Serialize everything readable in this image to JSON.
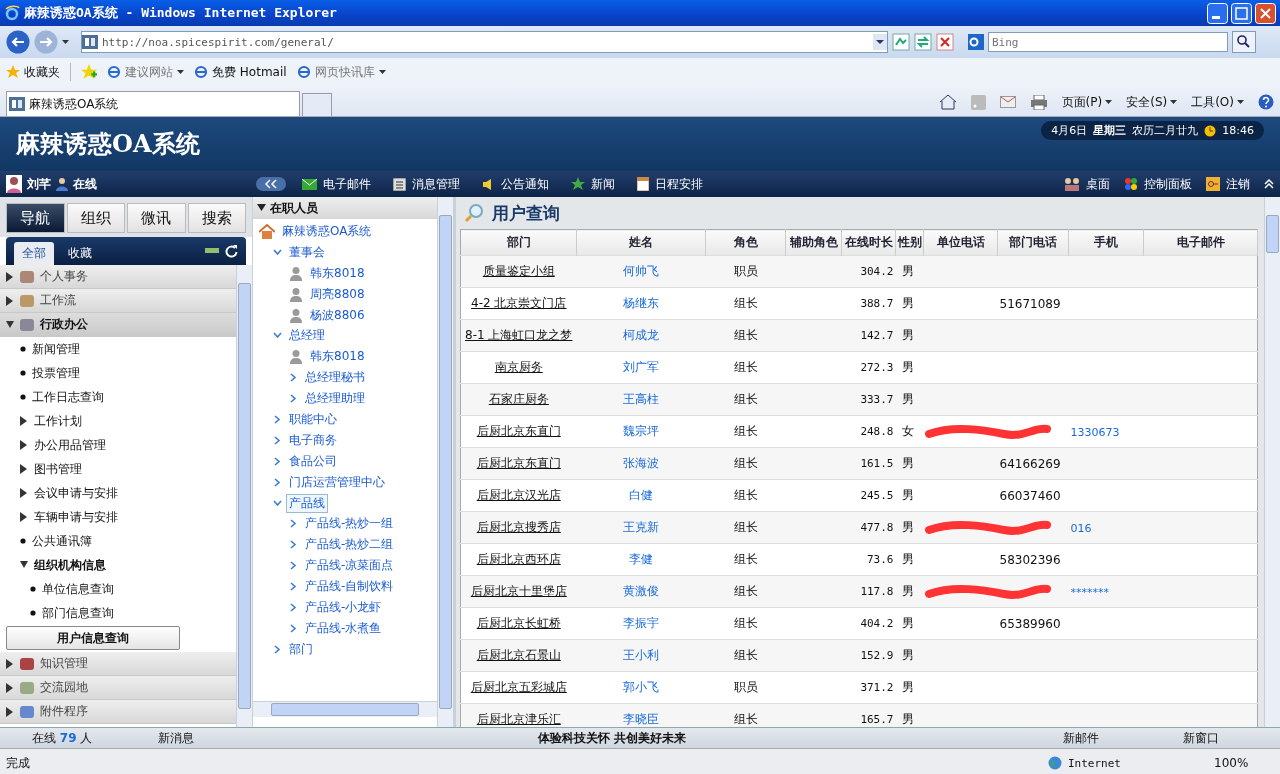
{
  "window": {
    "title": "麻辣诱惑OA系统 - Windows Internet Explorer"
  },
  "browser": {
    "url": "http://noa.spicespirit.com/general/",
    "search_placeholder": "Bing",
    "favorites": [
      {
        "label": "收藏夹",
        "kind": "star"
      },
      {
        "label": "建议网站",
        "kind": "dropdown"
      },
      {
        "label": "免费 Hotmail",
        "kind": "link"
      },
      {
        "label": "网页快讯库",
        "kind": "dropdown"
      }
    ],
    "tab": "麻辣诱惑OA系统",
    "commands": [
      "页面(P)",
      "安全(S)",
      "工具(O)"
    ],
    "status": "完成",
    "zone": "Internet",
    "zoom": "100%"
  },
  "app": {
    "title": "麻辣诱惑OA系统",
    "date": "4月6日",
    "weekday": "星期三",
    "lunar": "农历二月廿九",
    "time": "18:46",
    "user": "刘芊",
    "presence": "在线",
    "menu": [
      "电子邮件",
      "消息管理",
      "公告通知",
      "新闻",
      "日程安排"
    ],
    "right_menu": [
      "桌面",
      "控制面板",
      "注销"
    ]
  },
  "sidebar": {
    "tabs": [
      {
        "label": "导航",
        "selected": true
      },
      {
        "label": "组织",
        "selected": false
      },
      {
        "label": "微讯",
        "selected": false
      },
      {
        "label": "搜索",
        "selected": false
      }
    ],
    "subtabs": [
      {
        "label": "全部",
        "selected": true
      },
      {
        "label": "收藏",
        "selected": false
      }
    ],
    "sections": [
      {
        "label": "个人事务",
        "expanded": false
      },
      {
        "label": "工作流",
        "expanded": false
      },
      {
        "label": "行政办公",
        "expanded": true,
        "children": [
          {
            "label": "新闻管理",
            "kind": "leaf",
            "selected": false
          },
          {
            "label": "投票管理",
            "kind": "leaf",
            "selected": false
          },
          {
            "label": "工作日志查询",
            "kind": "leaf",
            "selected": false
          },
          {
            "label": "工作计划",
            "kind": "folder",
            "expanded": false
          },
          {
            "label": "办公用品管理",
            "kind": "folder",
            "expanded": false
          },
          {
            "label": "图书管理",
            "kind": "folder",
            "expanded": false
          },
          {
            "label": "会议申请与安排",
            "kind": "folder",
            "expanded": false
          },
          {
            "label": "车辆申请与安排",
            "kind": "folder",
            "expanded": false
          },
          {
            "label": "公共通讯簿",
            "kind": "leaf",
            "selected": false
          },
          {
            "label": "组织机构信息",
            "kind": "folder",
            "expanded": true,
            "children": [
              {
                "label": "单位信息查询",
                "selected": false
              },
              {
                "label": "部门信息查询",
                "selected": false
              },
              {
                "label": "用户信息查询",
                "selected": true
              }
            ]
          }
        ]
      },
      {
        "label": "知识管理",
        "expanded": false
      },
      {
        "label": "交流园地",
        "expanded": false
      },
      {
        "label": "附件程序",
        "expanded": false
      }
    ]
  },
  "tree": {
    "title": "在职人员",
    "root": "麻辣诱惑OA系统",
    "children": [
      {
        "label": "董事会",
        "kind": "group",
        "expanded": true,
        "selected": false,
        "children": [
          {
            "label": "韩东8018",
            "kind": "person"
          },
          {
            "label": "周亮8808",
            "kind": "person"
          },
          {
            "label": "杨波8806",
            "kind": "person"
          }
        ]
      },
      {
        "label": "总经理",
        "kind": "group",
        "expanded": true,
        "selected": false,
        "children": [
          {
            "label": "韩东8018",
            "kind": "person"
          },
          {
            "label": "总经理秘书",
            "kind": "group",
            "expanded": false,
            "selected": false
          },
          {
            "label": "总经理助理",
            "kind": "group",
            "expanded": false,
            "selected": false
          }
        ]
      },
      {
        "label": "职能中心",
        "kind": "group",
        "expanded": false,
        "selected": false
      },
      {
        "label": "电子商务",
        "kind": "group",
        "expanded": false,
        "selected": false
      },
      {
        "label": "食品公司",
        "kind": "group",
        "expanded": false,
        "selected": false
      },
      {
        "label": "门店运营管理中心",
        "kind": "group",
        "expanded": false,
        "selected": false
      },
      {
        "label": "产品线",
        "kind": "group",
        "expanded": true,
        "selected": true,
        "children": [
          {
            "label": "产品线-热炒一组",
            "kind": "group",
            "expanded": false,
            "selected": false
          },
          {
            "label": "产品线-热炒二组",
            "kind": "group",
            "expanded": false,
            "selected": false
          },
          {
            "label": "产品线-凉菜面点",
            "kind": "group",
            "expanded": false,
            "selected": false
          },
          {
            "label": "产品线-自制饮料",
            "kind": "group",
            "expanded": false,
            "selected": false
          },
          {
            "label": "产品线-小龙虾",
            "kind": "group",
            "expanded": false,
            "selected": false
          },
          {
            "label": "产品线-水煮鱼",
            "kind": "group",
            "expanded": false,
            "selected": false
          }
        ]
      },
      {
        "label": "部门",
        "kind": "group",
        "expanded": false,
        "selected": false
      }
    ]
  },
  "content": {
    "title": "用户查询",
    "table": {
      "columns": [
        "部门",
        "姓名",
        "角色",
        "辅助角色",
        "在线时长",
        "性别",
        "单位电话",
        "部门电话",
        "手机",
        "电子邮件"
      ],
      "rows": [
        {
          "dept": "质量鉴定小组",
          "name": "何帅飞",
          "role": "职员",
          "hours": "304.2",
          "gender": "男",
          "dept_phone": "",
          "mobile": "",
          "redacted": false
        },
        {
          "dept": "4-2 北京崇文门店",
          "name": "杨继东",
          "role": "组长",
          "hours": "388.7",
          "gender": "男",
          "dept_phone": "51671089",
          "mobile": "",
          "redacted": false
        },
        {
          "dept": "8-1 上海虹口龙之梦",
          "name": "柯成龙",
          "role": "组长",
          "hours": "142.7",
          "gender": "男",
          "dept_phone": "",
          "mobile": "",
          "redacted": false
        },
        {
          "dept": "南京厨务",
          "name": "刘广军",
          "role": "组长",
          "hours": "272.3",
          "gender": "男",
          "dept_phone": "",
          "mobile": "",
          "redacted": false
        },
        {
          "dept": "石家庄厨务",
          "name": "王高柱",
          "role": "组长",
          "hours": "333.7",
          "gender": "男",
          "dept_phone": "",
          "mobile": "",
          "redacted": false
        },
        {
          "dept": "后厨北京东直门",
          "name": "魏宗坪",
          "role": "组长",
          "hours": "248.8",
          "gender": "女",
          "dept_phone": "",
          "mobile": "1330673",
          "redacted": true
        },
        {
          "dept": "后厨北京东直门",
          "name": "张海波",
          "role": "组长",
          "hours": "161.5",
          "gender": "男",
          "dept_phone": "64166269",
          "mobile": "",
          "redacted": false
        },
        {
          "dept": "后厨北京汉光店",
          "name": "白健",
          "role": "组长",
          "hours": "245.5",
          "gender": "男",
          "dept_phone": "66037460",
          "mobile": "",
          "redacted": false
        },
        {
          "dept": "后厨北京搜秀店",
          "name": "王克新",
          "role": "组长",
          "hours": "477.8",
          "gender": "男",
          "dept_phone": "",
          "mobile": "016",
          "redacted": true
        },
        {
          "dept": "后厨北京西环店",
          "name": "李健",
          "role": "组长",
          "hours": "73.6",
          "gender": "男",
          "dept_phone": "58302396",
          "mobile": "",
          "redacted": false
        },
        {
          "dept": "后厨北京十里堡店",
          "name": "黄激俊",
          "role": "组长",
          "hours": "117.8",
          "gender": "男",
          "dept_phone": "",
          "mobile": "*******",
          "redacted": true
        },
        {
          "dept": "后厨北京长虹桥",
          "name": "李振宇",
          "role": "组长",
          "hours": "404.2",
          "gender": "男",
          "dept_phone": "65389960",
          "mobile": "",
          "redacted": false
        },
        {
          "dept": "后厨北京石景山",
          "name": "王小利",
          "role": "组长",
          "hours": "152.9",
          "gender": "男",
          "dept_phone": "",
          "mobile": "",
          "redacted": false
        },
        {
          "dept": "后厨北京五彩城店",
          "name": "郭小飞",
          "role": "职员",
          "hours": "371.2",
          "gender": "男",
          "dept_phone": "",
          "mobile": "",
          "redacted": false
        },
        {
          "dept": "后厨北京津乐汇",
          "name": "李晓臣",
          "role": "组长",
          "hours": "165.7",
          "gender": "男",
          "dept_phone": "",
          "mobile": "",
          "redacted": false
        }
      ]
    }
  },
  "footer": {
    "online_label": "在线",
    "online_count": "79",
    "online_unit": "人",
    "messages": "新消息",
    "slogan": "体验科技关怀 共创美好未来",
    "mail": "新邮件",
    "new_window": "新窗口"
  }
}
